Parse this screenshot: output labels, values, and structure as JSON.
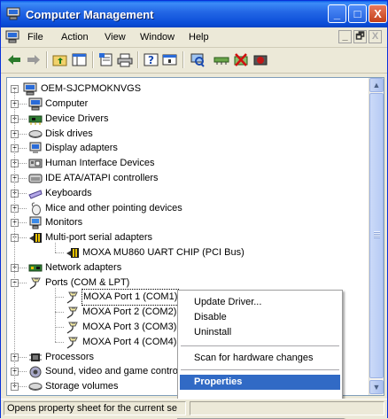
{
  "window": {
    "title": "Computer Management",
    "controls": {
      "minimize": "_",
      "maximize": "□",
      "close": "X"
    }
  },
  "menubar": {
    "items": [
      "File",
      "Action",
      "View",
      "Window",
      "Help"
    ],
    "mdi_controls": [
      "_",
      "🗗",
      "X"
    ]
  },
  "toolbar": {
    "buttons": [
      "back-icon",
      "forward-icon",
      "up-folder-icon",
      "show-hide-tree-icon",
      "properties-icon",
      "print-icon",
      "help-icon",
      "console-icon",
      "scan-hardware-icon",
      "update-driver-icon",
      "uninstall-icon",
      "disable-icon"
    ]
  },
  "tree": {
    "root": "OEM-SJCPMOKNVGS",
    "nodes": [
      {
        "label": "Computer",
        "icon": "computer-icon",
        "expand": "+"
      },
      {
        "label": "Device Drivers",
        "icon": "board-icon",
        "expand": "+"
      },
      {
        "label": "Disk drives",
        "icon": "disk-icon",
        "expand": "+"
      },
      {
        "label": "Display adapters",
        "icon": "display-icon",
        "expand": "+"
      },
      {
        "label": "Human Interface Devices",
        "icon": "hid-icon",
        "expand": "+"
      },
      {
        "label": "IDE ATA/ATAPI controllers",
        "icon": "ide-icon",
        "expand": "+"
      },
      {
        "label": "Keyboards",
        "icon": "keyboard-icon",
        "expand": "+"
      },
      {
        "label": "Mice and other pointing devices",
        "icon": "mouse-icon",
        "expand": "+"
      },
      {
        "label": "Monitors",
        "icon": "monitor-icon",
        "expand": "+"
      },
      {
        "label": "Multi-port serial adapters",
        "icon": "serial-adapter-icon",
        "expand": "−"
      },
      {
        "label": "MOXA MU860 UART CHIP (PCI Bus)",
        "icon": "serial-adapter-icon",
        "child": true
      },
      {
        "label": "Network adapters",
        "icon": "network-icon",
        "expand": "+"
      },
      {
        "label": "Ports (COM & LPT)",
        "icon": "port-icon",
        "expand": "−"
      },
      {
        "label": "MOXA Port 1 (COM1)",
        "icon": "port-icon",
        "child": true,
        "selected": true
      },
      {
        "label": "MOXA Port 2 (COM2)",
        "icon": "port-icon",
        "child": true
      },
      {
        "label": "MOXA Port 3 (COM3)",
        "icon": "port-icon",
        "child": true
      },
      {
        "label": "MOXA Port 4 (COM4)",
        "icon": "port-icon",
        "child": true
      },
      {
        "label": "Processors",
        "icon": "processor-icon",
        "expand": "+"
      },
      {
        "label": "Sound, video and game controllers",
        "icon": "sound-icon",
        "expand": "+"
      },
      {
        "label": "Storage volumes",
        "icon": "disk-icon",
        "expand": "+"
      }
    ]
  },
  "context_menu": {
    "items": [
      {
        "label": "Update Driver...",
        "highlighted": false
      },
      {
        "label": "Disable",
        "highlighted": false
      },
      {
        "label": "Uninstall",
        "highlighted": false
      },
      {
        "separator": true
      },
      {
        "label": "Scan for hardware changes",
        "highlighted": false
      },
      {
        "separator": true
      },
      {
        "label": "Properties",
        "highlighted": true
      }
    ]
  },
  "statusbar": {
    "text": "Opens property sheet for the current se"
  },
  "colors": {
    "titlebar": "#0a4dd8",
    "selection": "#316ac5",
    "window_bg": "#ece9d8"
  }
}
